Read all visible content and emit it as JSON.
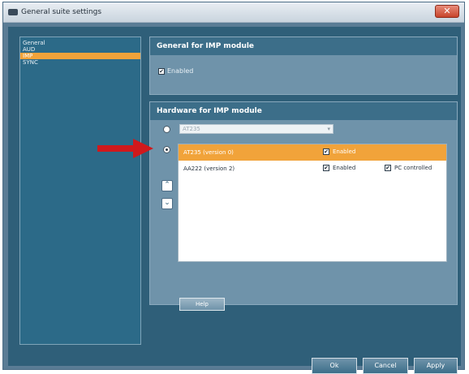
{
  "window": {
    "title": "General suite settings",
    "close_label": "✕"
  },
  "nav": {
    "items": [
      {
        "label": "General",
        "selected": false
      },
      {
        "label": "AUD",
        "selected": false
      },
      {
        "label": "IMP",
        "selected": true
      },
      {
        "label": "SYNC",
        "selected": false
      }
    ]
  },
  "general_group": {
    "title": "General for IMP module",
    "enabled_label": "Enabled",
    "enabled_checked": true
  },
  "hardware_group": {
    "title": "Hardware for IMP module",
    "combo_value": "AT235",
    "combo_arrow": "▾",
    "devices": [
      {
        "name": "AT235 (version 0)",
        "enabled_label": "Enabled",
        "enabled_checked": true,
        "selected": true
      },
      {
        "name": "AA222 (version 2)",
        "enabled_label": "Enabled",
        "enabled_checked": true,
        "pc_label": "PC controlled",
        "pc_checked": true,
        "selected": false
      }
    ],
    "move_up_glyph": "⌃",
    "move_down_glyph": "⌄",
    "help_label": "Help"
  },
  "footer": {
    "ok_label": "Ok",
    "cancel_label": "Cancel",
    "apply_label": "Apply"
  },
  "colors": {
    "accent_orange": "#f1a33a",
    "annotation_red": "#d0191c",
    "panel_blue": "#2f5f79"
  }
}
